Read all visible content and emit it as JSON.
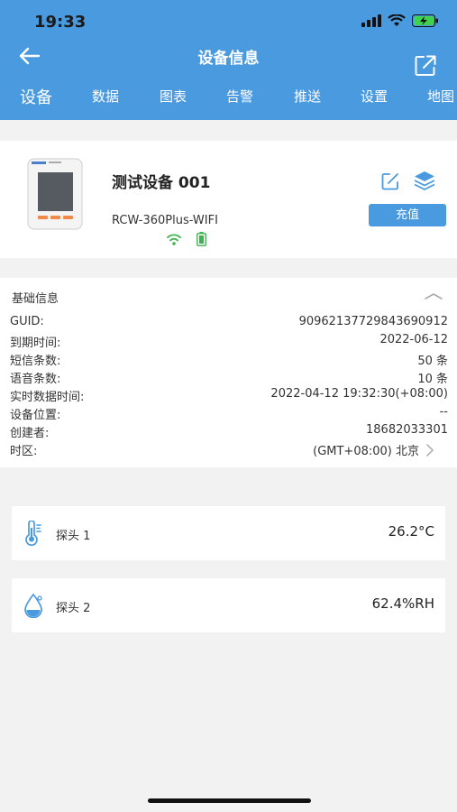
{
  "status_bar": {
    "time": "19:33"
  },
  "header": {
    "title": "设备信息"
  },
  "tabs": [
    {
      "label": "设备"
    },
    {
      "label": "数据"
    },
    {
      "label": "图表"
    },
    {
      "label": "告警"
    },
    {
      "label": "推送"
    },
    {
      "label": "设置"
    },
    {
      "label": "地图"
    }
  ],
  "device": {
    "name": "测试设备 001",
    "model": "RCW-360Plus-WIFI",
    "recharge_label": "充值"
  },
  "basic_info": {
    "title": "基础信息",
    "rows": [
      {
        "label": "GUID:",
        "value": "90962137729843690912"
      },
      {
        "label": "到期时间:",
        "value": "2022-06-12"
      },
      {
        "label": "短信条数:",
        "value": "50 条"
      },
      {
        "label": "语音条数:",
        "value": "10 条"
      },
      {
        "label": "实时数据时间:",
        "value": "2022-04-12 19:32:30(+08:00)"
      },
      {
        "label": "设备位置:",
        "value": "--"
      },
      {
        "label": "创建者:",
        "value": "18682033301"
      },
      {
        "label": "时区:",
        "value": "(GMT+08:00) 北京"
      }
    ]
  },
  "probes": [
    {
      "name": "探头 1",
      "value": "26.2°C",
      "icon": "thermometer-icon"
    },
    {
      "name": "探头 2",
      "value": "62.4%RH",
      "icon": "humidity-drop-icon"
    }
  ],
  "colors": {
    "accent": "#4a9ae0",
    "wifi_green": "#3fb24f"
  }
}
